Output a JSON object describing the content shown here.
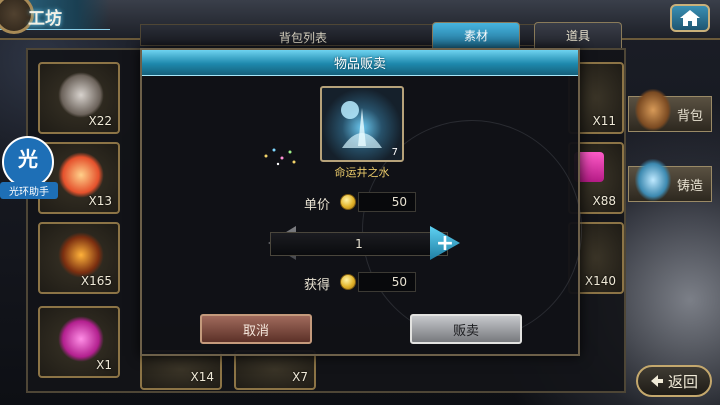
{
  "header": {
    "title": "工坊"
  },
  "tabs": {
    "list_label": "背包列表",
    "materials": "素材",
    "props": "道具",
    "active": "素材"
  },
  "inventory": {
    "left_counts": [
      "X22",
      "X13",
      "X165",
      "X1"
    ],
    "right_counts": [
      "X11",
      "X88",
      "X140"
    ],
    "bottom_counts": [
      "X14",
      "X7"
    ]
  },
  "side": {
    "bag_label": "背包",
    "forge_label": "铸造",
    "back_label": "返回"
  },
  "assistant": {
    "char": "光",
    "label": "光环助手"
  },
  "dialog": {
    "title": "物品贩卖",
    "item_name": "命运井之水",
    "item_count": "7",
    "unit_price_label": "单价",
    "unit_price": "50",
    "quantity": "1",
    "gain_label": "获得",
    "gain": "50",
    "cancel": "取消",
    "sell": "贩卖"
  },
  "colors": {
    "accent": "#47b4de",
    "gold": "#e9c96a",
    "frame": "#8c7446"
  }
}
